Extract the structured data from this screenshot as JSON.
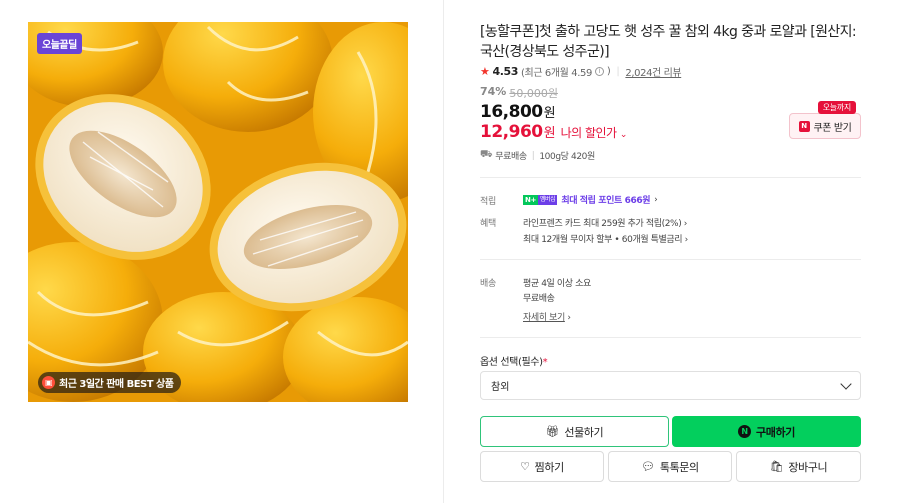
{
  "product": {
    "title": "[농할쿠폰]첫 출하 고당도 햇 성주 꿀 참외 4kg 중과 로얄과 [원산지: 국산(경상북도 성주군)]",
    "badges": {
      "today": "오늘끝딜",
      "best": "최근 3일간 판매 BEST 상품"
    }
  },
  "rating": {
    "score": "4.53",
    "recent": "(최근 6개월 4.59",
    "recent_close": ")",
    "reviews": "2,024건 리뷰"
  },
  "price": {
    "discount_rate": "74%",
    "original": "50,000원",
    "sale": "16,800",
    "sale_unit": "원",
    "my_price": "12,960",
    "my_price_unit": "원",
    "my_price_label": "나의 할인가",
    "coupon_tag": "오늘까지",
    "coupon_btn": "쿠폰 받기"
  },
  "shipping": {
    "fee": "무료배송",
    "unit_price": "100g당 420원"
  },
  "specs": {
    "points_label": "적립",
    "points_badge_n": "N+",
    "points_badge_p": "멤버십",
    "points_text": "최대 적립 포인트 666원",
    "benefit_label": "혜택",
    "benefit_1": "라인프렌즈 카드 최대 259원 추가 적립(2%)",
    "benefit_2": "최대 12개월 무이자 할부 • 60개월 특별금리",
    "delivery_label": "배송",
    "delivery_1": "평균 4일 이상 소요",
    "delivery_2": "무료배송",
    "delivery_more": "자세히 보기"
  },
  "options": {
    "label": "옵션 선택",
    "required": "(필수)",
    "selected": "참외"
  },
  "buttons": {
    "gift": "선물하기",
    "buy": "구매하기",
    "wish": "찜하기",
    "talk": "톡톡문의",
    "cart": "장바구니"
  },
  "colors": {
    "accent_green": "#03cf5d",
    "accent_red": "#e5113a",
    "purple": "#6c3ee8"
  }
}
